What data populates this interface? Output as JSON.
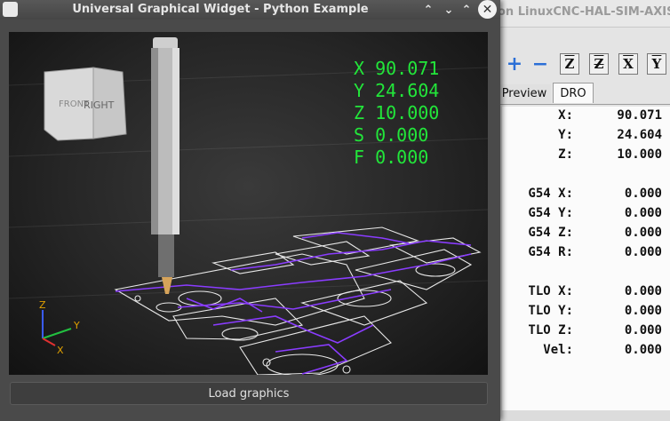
{
  "background_window": {
    "title": "on LinuxCNC-HAL-SIM-AXIS",
    "toolbar": {
      "zoom_in": "+",
      "zoom_out": "−",
      "view_z": "Z",
      "view_z2": "Z",
      "view_x": "X",
      "view_y": "Y"
    },
    "tabs": {
      "preview": "Preview",
      "dro": "DRO"
    },
    "dro": [
      {
        "label": "X:",
        "value": "90.071"
      },
      {
        "label": "Y:",
        "value": "24.604"
      },
      {
        "label": "Z:",
        "value": "10.000"
      },
      {
        "label": "G54 X:",
        "value": "0.000"
      },
      {
        "label": "G54 Y:",
        "value": "0.000"
      },
      {
        "label": "G54 Z:",
        "value": "0.000"
      },
      {
        "label": "G54 R:",
        "value": "0.000"
      },
      {
        "label": "TLO X:",
        "value": "0.000"
      },
      {
        "label": "TLO Y:",
        "value": "0.000"
      },
      {
        "label": "TLO Z:",
        "value": "0.000"
      },
      {
        "label": "Vel:",
        "value": "0.000"
      }
    ]
  },
  "widget_window": {
    "title": "Universal Graphical Widget - Python Example",
    "buttons": {
      "minimize_up": "⌃",
      "minimize": "⌄",
      "maximize": "⌃",
      "close": "✕"
    },
    "viewport": {
      "cube_faces": {
        "front": "FRONT",
        "right": "RIGHT"
      },
      "axis_labels": {
        "x": "X",
        "y": "Y",
        "z": "Z"
      },
      "overlay": [
        {
          "axis": "X",
          "value": "90.071"
        },
        {
          "axis": "Y",
          "value": "24.604"
        },
        {
          "axis": "Z",
          "value": "10.000"
        },
        {
          "axis": "S",
          "value": "0.000"
        },
        {
          "axis": "F",
          "value": "0.000"
        }
      ],
      "colors": {
        "dro_text": "#22e63a",
        "toolpath": "#8a3cff",
        "part_outline": "#e8e8e8"
      }
    },
    "load_button": "Load graphics"
  }
}
